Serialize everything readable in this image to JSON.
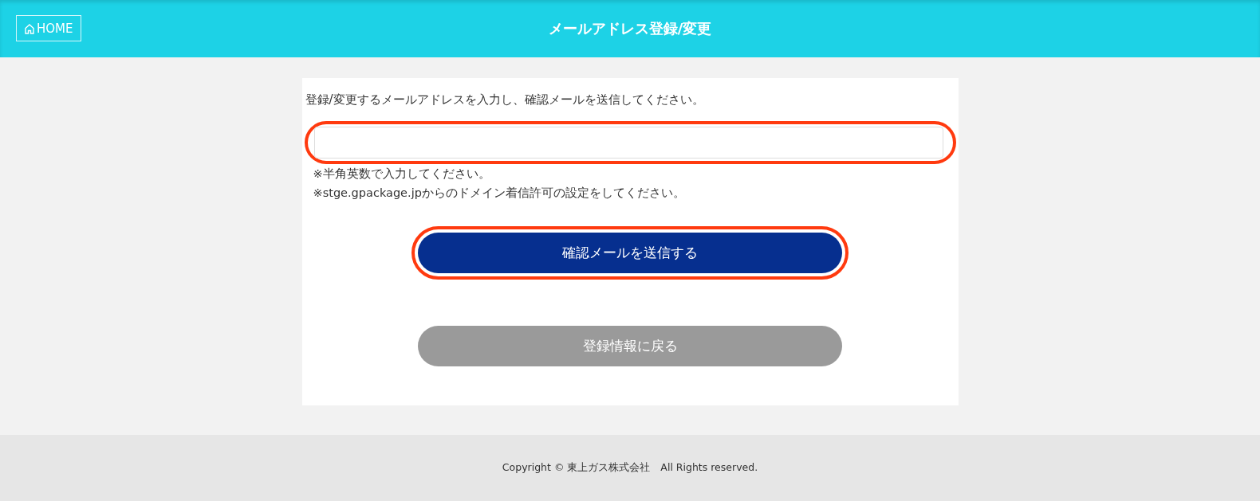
{
  "header": {
    "home_button": "HOME",
    "title": "メールアドレス登録/変更"
  },
  "form": {
    "instruction": "登録/変更するメールアドレスを入力し、確認メールを送信してください。",
    "email_field": {
      "highlighted": true
    },
    "notes": [
      "※半角英数で入力してください。",
      "※stge.gpackage.jpからのドメイン着信許可の設定をしてください。"
    ],
    "buttons": [
      {
        "kind": "primary",
        "label": "確認メールを送信する",
        "highlighted": true
      },
      {
        "kind": "secondary",
        "label": "登録情報に戻る",
        "highlighted": false
      }
    ]
  },
  "footer": {
    "copyright": "Copyright © 東上ガス株式会社　All Rights reserved."
  }
}
